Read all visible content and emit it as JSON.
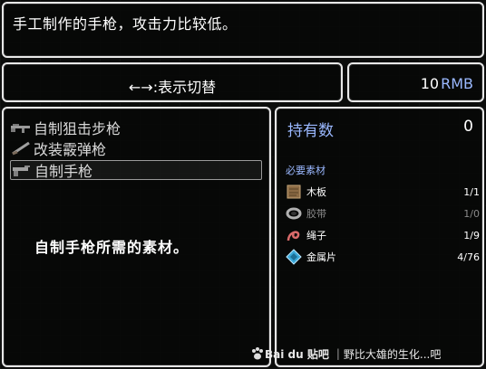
{
  "description": "手工制作的手枪，攻击力比较低。",
  "switch_hint": "←→:表示切替",
  "money": {
    "amount": "10",
    "unit": "RMB"
  },
  "recipe_list": {
    "items": [
      {
        "label": "自制狙击步枪",
        "icon": "rifle-icon",
        "selected": false
      },
      {
        "label": "改装霰弹枪",
        "icon": "shotgun-icon",
        "selected": false
      },
      {
        "label": "自制手枪",
        "icon": "pistol-icon",
        "selected": true
      }
    ],
    "message": "自制手枪所需的素材。"
  },
  "info": {
    "held_label": "持有数",
    "held_count": "0",
    "required_header": "必要素材",
    "materials": [
      {
        "name": "木板",
        "count": "1/1",
        "icon": "wood-plank-icon",
        "available": true
      },
      {
        "name": "胶带",
        "count": "1/0",
        "icon": "tape-icon",
        "available": false
      },
      {
        "name": "绳子",
        "count": "1/9",
        "icon": "rope-icon",
        "available": true
      },
      {
        "name": "金属片",
        "count": "4/76",
        "icon": "metal-shard-icon",
        "available": true
      }
    ]
  },
  "watermark": {
    "brand": "Bai du 贴吧",
    "text": "野比大雄的生化...吧"
  },
  "colors": {
    "accent": "#9ab8ff",
    "border": "#e8e8e8",
    "background": "#0a0b0a"
  }
}
